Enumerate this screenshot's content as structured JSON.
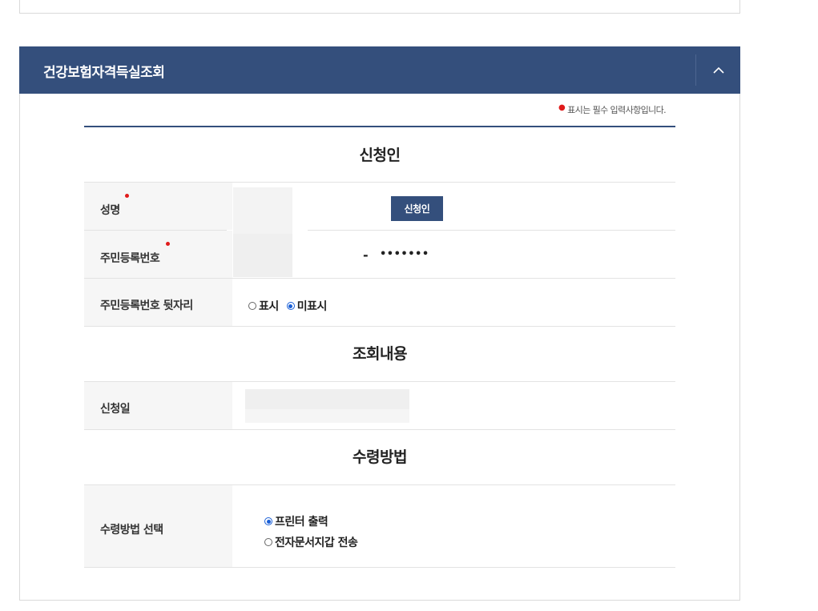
{
  "panel": {
    "title": "건강보험자격득실조회"
  },
  "required_note": "표시는 필수 입력사항입니다.",
  "sections": {
    "applicant": "신청인",
    "query": "조회내용",
    "receipt": "수령방법"
  },
  "fields": {
    "name_label": "성명",
    "rrn_label": "주민등록번호",
    "rrn_back_label": "주민등록번호 뒷자리",
    "apply_date_label": "신청일",
    "receipt_method_label": "수령방법 선택"
  },
  "applicant_button": "신청인",
  "rrn": {
    "dash": "-",
    "masked": "•••••••"
  },
  "rrn_back_options": [
    {
      "label": "표시",
      "checked": false
    },
    {
      "label": "미표시",
      "checked": true
    }
  ],
  "receipt_options": [
    {
      "label": "프린터 출력",
      "checked": true
    },
    {
      "label": "전자문서지갑 전송",
      "checked": false
    }
  ]
}
